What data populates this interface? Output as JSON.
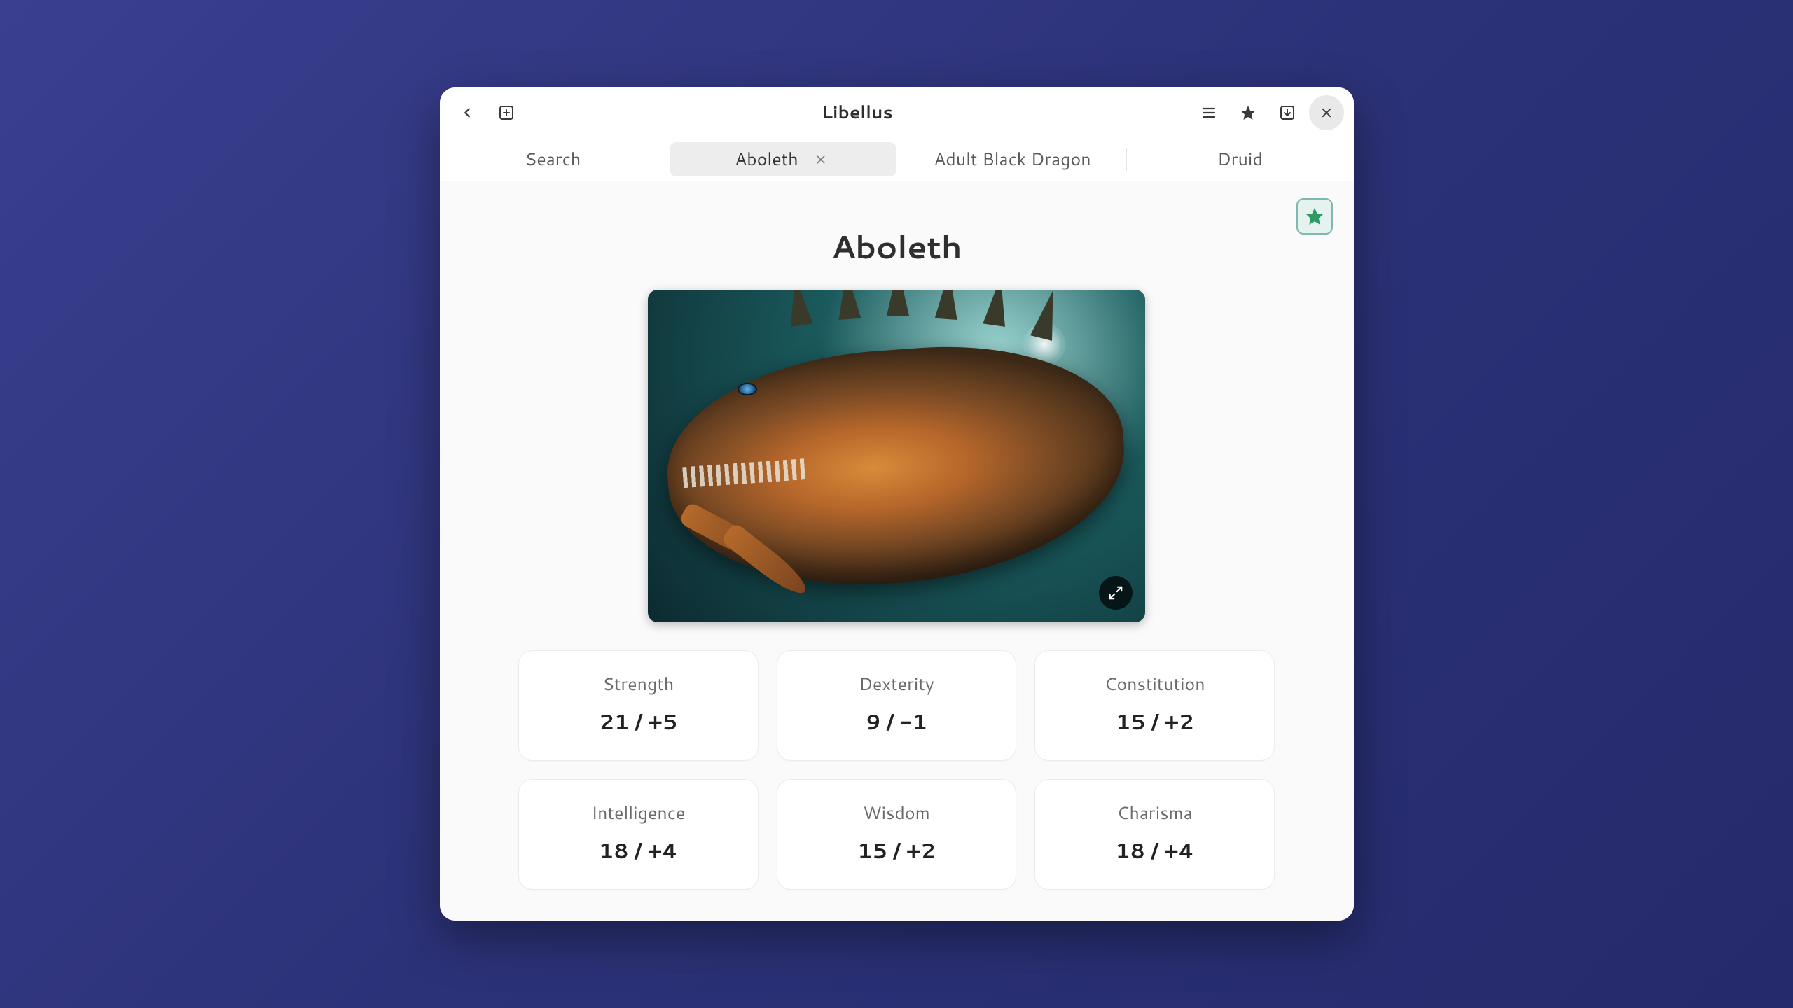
{
  "app": {
    "title": "Libellus"
  },
  "tabs": [
    {
      "label": "Search",
      "active": false,
      "closable": false
    },
    {
      "label": "Aboleth",
      "active": true,
      "closable": true
    },
    {
      "label": "Adult Black Dragon",
      "active": false,
      "closable": false
    },
    {
      "label": "Druid",
      "active": false,
      "closable": false
    }
  ],
  "page": {
    "title": "Aboleth",
    "favorited": true
  },
  "stats": [
    {
      "label": "Strength",
      "value": "21 / +5"
    },
    {
      "label": "Dexterity",
      "value": "9 / -1"
    },
    {
      "label": "Constitution",
      "value": "15 / +2"
    },
    {
      "label": "Intelligence",
      "value": "18 / +4"
    },
    {
      "label": "Wisdom",
      "value": "15 / +2"
    },
    {
      "label": "Charisma",
      "value": "18 / +4"
    }
  ]
}
